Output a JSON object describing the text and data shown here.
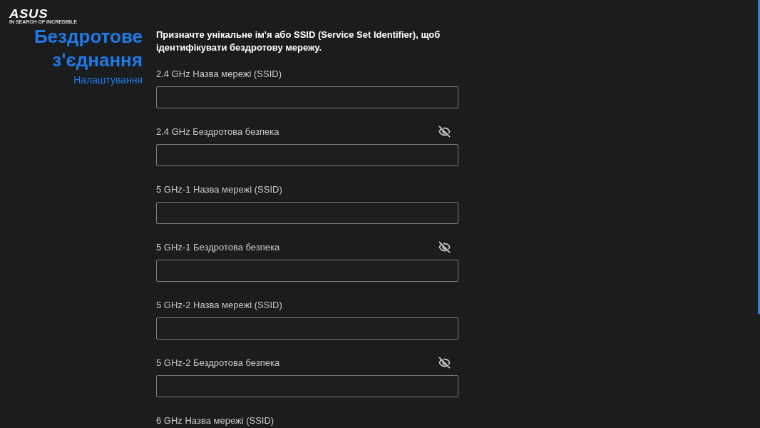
{
  "logo": {
    "wordmark": "ASUS",
    "tagline": "IN SEARCH OF INCREDIBLE"
  },
  "sidebar": {
    "title": "Бездротове з'єднання",
    "subtitle": "Налаштування"
  },
  "description": "Призначте унікальне ім'я або SSID (Service Set Identifier), щоб ідентифікувати бездротову мережу.",
  "fields": [
    {
      "label": "2.4 GHz Назва мережі (SSID)",
      "kind": "text"
    },
    {
      "label": "2.4 GHz Бездротова безпека",
      "kind": "password",
      "password_hidden": true
    },
    {
      "label": "5 GHz-1 Назва мережі (SSID)",
      "kind": "text"
    },
    {
      "label": "5 GHz-1 Бездротова безпека",
      "kind": "password",
      "password_hidden": true
    },
    {
      "label": "5 GHz-2 Назва мережі (SSID)",
      "kind": "text"
    },
    {
      "label": "5 GHz-2 Бездротова безпека",
      "kind": "password",
      "password_hidden": true
    },
    {
      "label": "6 GHz Назва мережі (SSID)",
      "kind": "cutoff"
    }
  ]
}
